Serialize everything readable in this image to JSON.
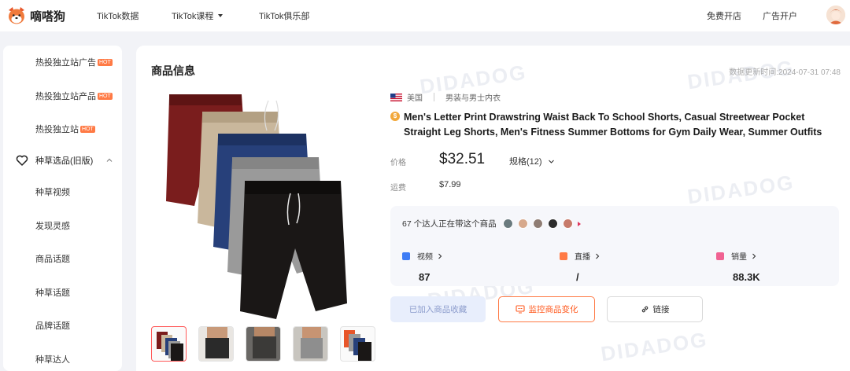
{
  "header": {
    "logo_text": "嘀嗒狗",
    "nav": [
      {
        "label": "TikTok数据"
      },
      {
        "label": "TikTok课程",
        "has_dropdown": true
      },
      {
        "label": "TikTok俱乐部"
      }
    ],
    "right": {
      "free_trial": "免费开店",
      "ad_account": "广告开户"
    }
  },
  "sidebar": {
    "items_top": [
      {
        "label": "热投独立站广告",
        "badge": "HOT"
      },
      {
        "label": "热投独立站产品",
        "badge": "HOT"
      },
      {
        "label": "热投独立站",
        "badge": "HOT"
      }
    ],
    "group": {
      "label": "种草选品(旧版)",
      "icon": "heart-icon",
      "expanded": true
    },
    "items_sub": [
      {
        "label": "种草视频"
      },
      {
        "label": "发现灵感"
      },
      {
        "label": "商品话题"
      },
      {
        "label": "种草话题"
      },
      {
        "label": "品牌话题"
      },
      {
        "label": "种草达人"
      }
    ]
  },
  "main": {
    "section_title": "商品信息",
    "update_time": "数据更新时间:2024-07-31 07:48",
    "watermark": "DIDADOG",
    "product": {
      "country": "美国",
      "category": "男装与男士内衣",
      "title": "Men's Letter Print Drawstring Waist Back To School Shorts, Casual Streetwear Pocket Straight Leg Shorts, Men's Fitness Summer Bottoms for Gym Daily Wear, Summer Outfits",
      "price_label": "价格",
      "price": "$32.51",
      "spec_label": "规格(12)",
      "shipping_label": "运费",
      "shipping": "$7.99"
    },
    "stats": {
      "creators_text": "67 个达人正在带这个商品",
      "items": [
        {
          "label": "视频",
          "value": "87",
          "icon": "video-icon",
          "color": "#3d7cf5"
        },
        {
          "label": "直播",
          "value": "/",
          "icon": "live-icon",
          "color": "#ff7a45"
        },
        {
          "label": "销量",
          "value": "88.3K",
          "icon": "sales-icon",
          "color": "#f06292"
        }
      ]
    },
    "buttons": {
      "favorite": "已加入商品收藏",
      "monitor": "监控商品变化",
      "link": "链接"
    }
  },
  "colors": {
    "accent": "#ff5a1f",
    "hot_badge": "#ff7a45",
    "product_colors": [
      "#7a1d1d",
      "#c9b79c",
      "#27407a",
      "#9a9a9a",
      "#1a1716"
    ]
  }
}
